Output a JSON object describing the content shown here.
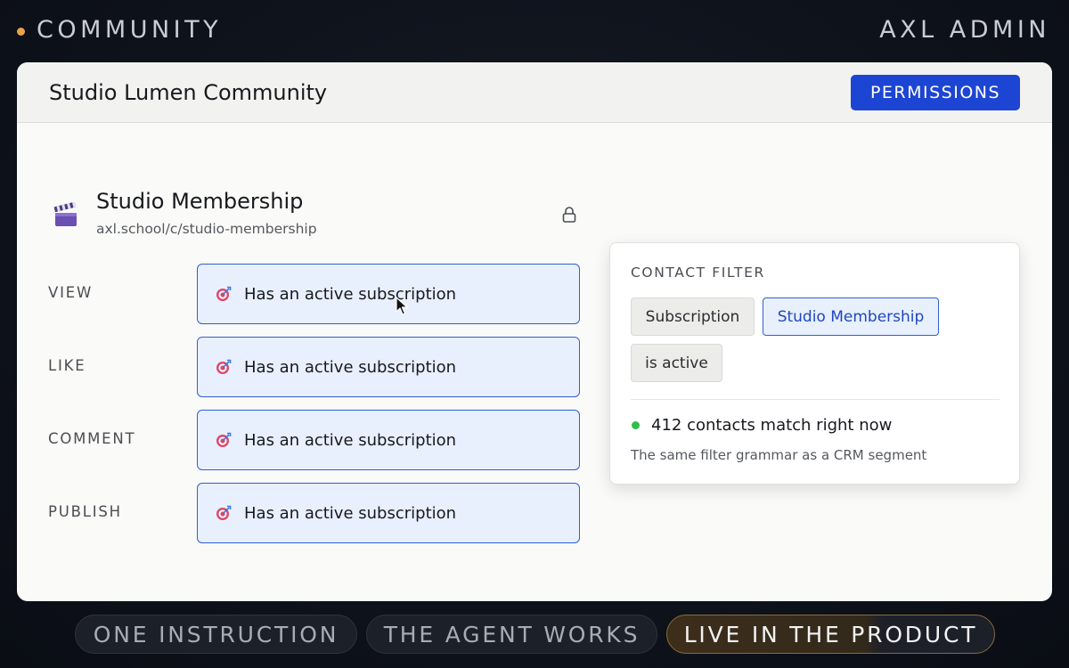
{
  "topbar": {
    "section_title": "COMMUNITY",
    "brand": "AXL ADMIN",
    "accent_color": "#e9a24a"
  },
  "card": {
    "title": "Studio Lumen Community",
    "permissions_label": "PERMISSIONS",
    "accent_color": "#1d45d3"
  },
  "group": {
    "icon": "clapperboard-icon",
    "name": "Studio Membership",
    "url": "axl.school/c/studio-membership",
    "lock_icon": "lock-icon"
  },
  "permissions": [
    {
      "label": "VIEW",
      "rule": "Has an active subscription"
    },
    {
      "label": "LIKE",
      "rule": "Has an active subscription"
    },
    {
      "label": "COMMENT",
      "rule": "Has an active subscription"
    },
    {
      "label": "PUBLISH",
      "rule": "Has an active subscription"
    }
  ],
  "filter": {
    "heading": "CONTACT FILTER",
    "chips": [
      {
        "label": "Subscription",
        "selected": false
      },
      {
        "label": "Studio Membership",
        "selected": true
      },
      {
        "label": "is active",
        "selected": false
      }
    ],
    "match_text": "412 contacts match right now",
    "note": "The same filter grammar as a CRM segment",
    "status_color": "#2fbf4a"
  },
  "steps": [
    {
      "label": "ONE INSTRUCTION",
      "active": false
    },
    {
      "label": "THE AGENT WORKS",
      "active": false
    },
    {
      "label": "LIVE IN THE PRODUCT",
      "active": true
    }
  ]
}
